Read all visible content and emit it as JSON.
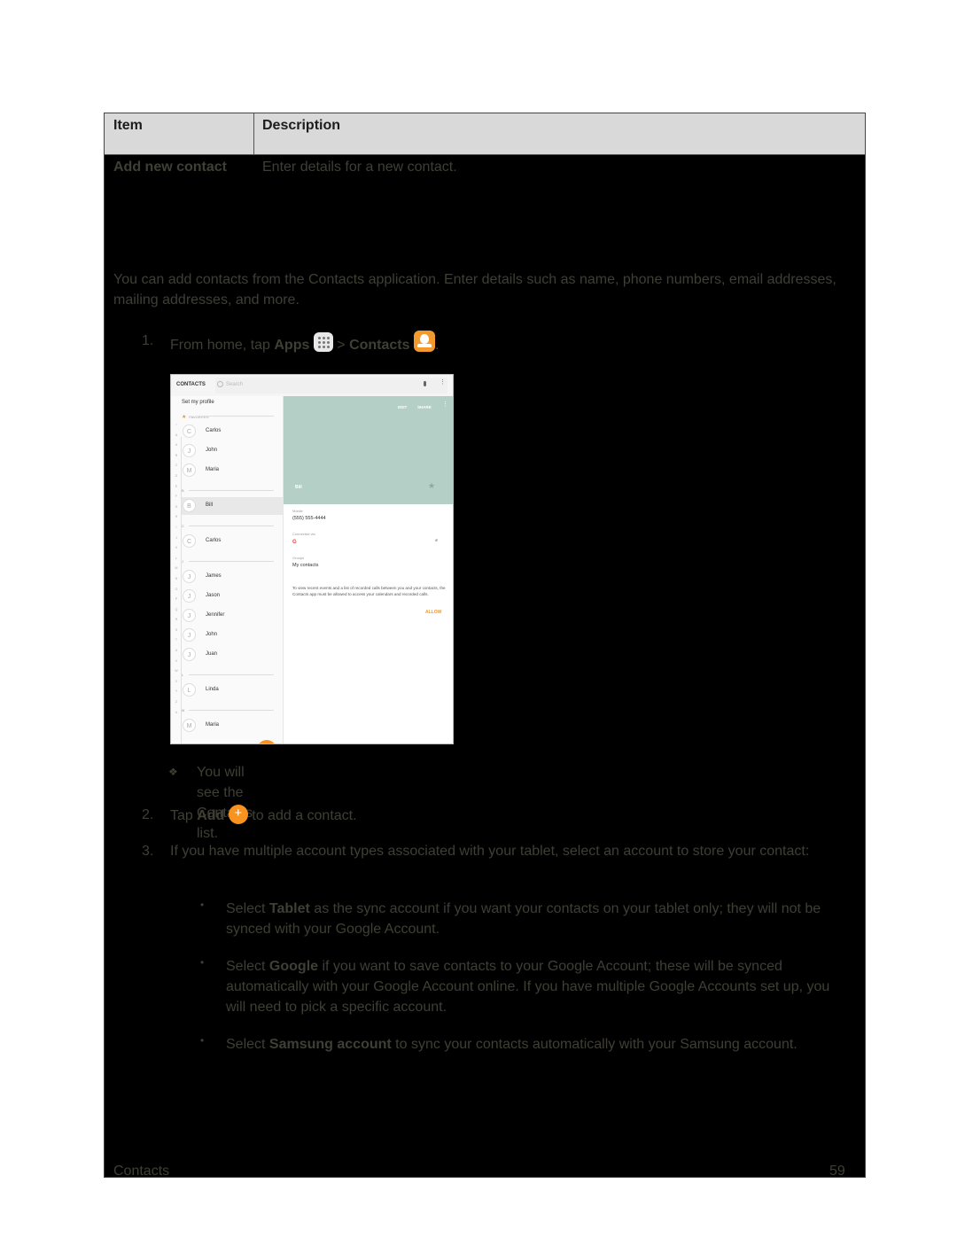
{
  "table": {
    "headers": [
      "Item",
      "Description"
    ],
    "rows": [
      {
        "item": "Add new contact",
        "description": "Enter details for a new contact."
      }
    ]
  },
  "intro": "You can add contacts from the Contacts application. Enter details such as name, phone numbers, email addresses, mailing addresses, and more.",
  "steps": [
    {
      "num": "1.",
      "pre": "From home, tap ",
      "b1": "Apps",
      "mid": " > ",
      "b2": "Contacts",
      "post": ".",
      "icons": [
        "apps-icon",
        "contacts-app-icon"
      ]
    },
    {
      "num": "2.",
      "pre": "Tap ",
      "b1": "Add",
      "post": " to add a contact.",
      "icons": [
        "add-icon"
      ]
    },
    {
      "num": "3.",
      "text": "If you have multiple account types associated with your tablet, select an account to store your contact:"
    }
  ],
  "result_note": "You will see the Contacts list.",
  "bullets": [
    {
      "pre": "Select ",
      "bold": "Tablet",
      "post": " as the sync account if you want your contacts on your tablet only; they will not be synced with your Google Account."
    },
    {
      "pre": "Select ",
      "bold": "Google",
      "post": " if you want to save contacts to your Google Account; these will be synced automatically with your Google Account online. If you have multiple Google Accounts set up, you will need to pick a specific account."
    },
    {
      "pre": "Select ",
      "bold": "Samsung account",
      "post": " to sync your contacts automatically with your Samsung account."
    }
  ],
  "screenshot": {
    "app_title": "CONTACTS",
    "search_placeholder": "Search",
    "set_profile": "Set my profile",
    "index_letters": [
      "☆",
      "&",
      "A",
      "B",
      "C",
      "D",
      "E",
      "F",
      "G",
      "H",
      "I",
      "J",
      "K",
      "L",
      "M",
      "N",
      "O",
      "P",
      "Q",
      "R",
      "S",
      "T",
      "U",
      "V",
      "W",
      "X",
      "Y",
      "Z",
      "#"
    ],
    "favorites_label": "FAVORITES",
    "favorites": [
      {
        "initial": "C",
        "name": "Carlos"
      },
      {
        "initial": "J",
        "name": "John"
      },
      {
        "initial": "M",
        "name": "Maria"
      }
    ],
    "sections": [
      {
        "letter": "B",
        "contacts": [
          {
            "initial": "B",
            "name": "Bill",
            "selected": true
          }
        ]
      },
      {
        "letter": "C",
        "contacts": [
          {
            "initial": "C",
            "name": "Carlos"
          }
        ]
      },
      {
        "letter": "J",
        "contacts": [
          {
            "initial": "J",
            "name": "James"
          },
          {
            "initial": "J",
            "name": "Jason"
          },
          {
            "initial": "J",
            "name": "Jennifer"
          },
          {
            "initial": "J",
            "name": "John"
          },
          {
            "initial": "J",
            "name": "Juan"
          }
        ]
      },
      {
        "letter": "L",
        "contacts": [
          {
            "initial": "L",
            "name": "Linda"
          }
        ]
      },
      {
        "letter": "M",
        "contacts": [
          {
            "initial": "M",
            "name": "Maria"
          }
        ]
      }
    ],
    "fab_label": "+",
    "detail": {
      "edit": "EDIT",
      "share": "SHARE",
      "name": "Bill",
      "mobile_label": "Mobile",
      "mobile_value": "(555) 555-4444",
      "connected_label": "Connected via",
      "connected_value": "G",
      "groups_label": "Groups",
      "groups_value": "My contacts",
      "permission_note": "To view recent events and a list of recorded calls between you and your contacts, the Contacts app must be allowed to access your calendars and recorded calls.",
      "allow": "ALLOW",
      "hero_color": "#b4d0c6",
      "accent_color": "#f29a2e"
    }
  },
  "footer": {
    "section": "Contacts",
    "page": "59"
  }
}
